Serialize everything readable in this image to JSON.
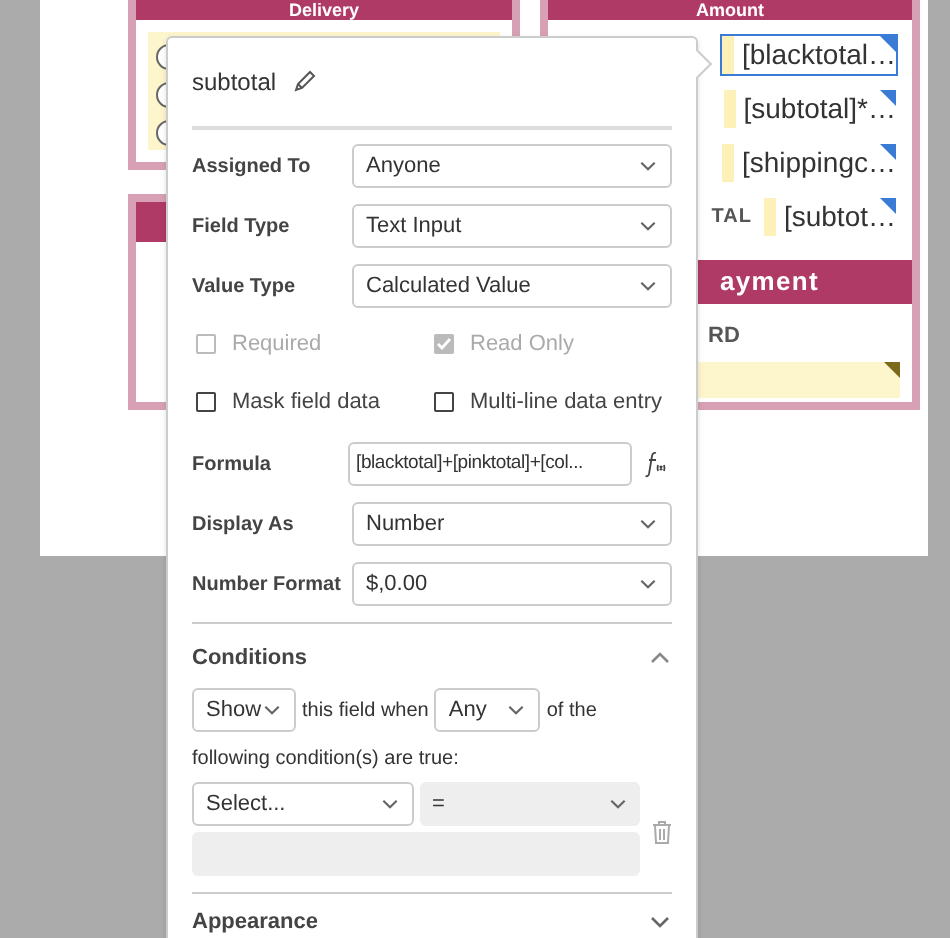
{
  "document": {
    "sections": [
      {
        "title": "Delivery",
        "radios": [
          {
            "selected": false
          },
          {
            "selected": false
          },
          {
            "selected": false
          }
        ]
      },
      {
        "title": "Amount",
        "fields": [
          "[blacktotal…",
          "[subtotal]*…",
          "[shippingc…",
          "[subtot…"
        ],
        "total_label": "TAL"
      },
      {
        "title": "ayment",
        "label": "RD"
      }
    ]
  },
  "popup": {
    "title": "subtotal",
    "selects": [
      {
        "label": "Assigned To",
        "value": "Anyone"
      },
      {
        "label": "Field Type",
        "value": "Text Input"
      },
      {
        "label": "Value Type",
        "value": "Calculated Value"
      }
    ],
    "checkboxes": [
      {
        "label": "Required",
        "checked": false,
        "disabled": true
      },
      {
        "label": "Read Only",
        "checked": true,
        "disabled": true
      },
      {
        "label": "Mask field data",
        "checked": false,
        "disabled": false
      },
      {
        "label": "Multi-line data entry",
        "checked": false,
        "disabled": false
      }
    ],
    "formula": {
      "label": "Formula",
      "value": "[blacktotal]+[pinktotal]+[col..."
    },
    "format_selects": [
      {
        "label": "Display As",
        "value": "Number"
      },
      {
        "label": "Number Format",
        "value": "$,0.00"
      }
    ],
    "conditions": {
      "title": "Conditions",
      "expanded": true,
      "action": "Show",
      "text_1": "this field when",
      "match": "Any",
      "text_2": "of the",
      "text_3": "following condition(s) are true:",
      "field": "Select...",
      "operator": "="
    },
    "appearance": {
      "title": "Appearance",
      "expanded": false
    }
  }
}
